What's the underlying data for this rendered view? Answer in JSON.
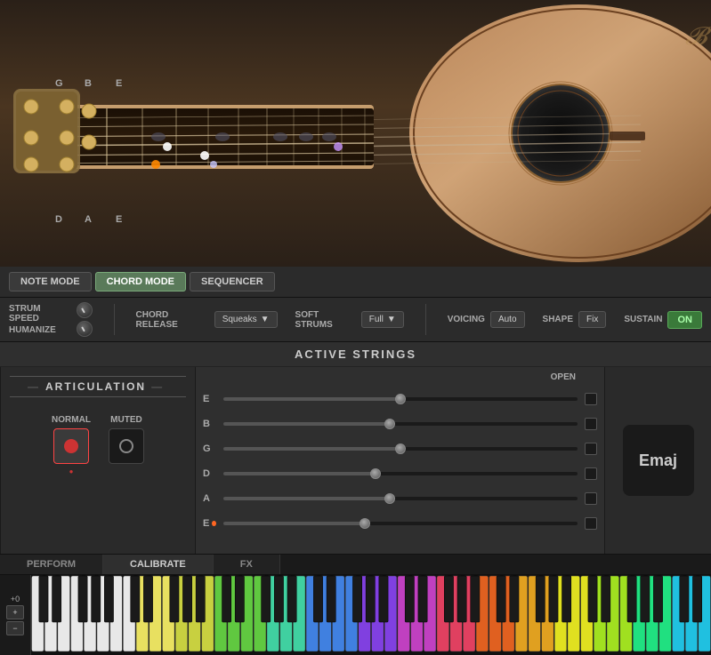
{
  "guitar": {
    "string_labels_top": [
      "G",
      "B",
      "E"
    ],
    "string_labels_bottom": [
      "D",
      "A",
      "E"
    ]
  },
  "modes": {
    "note_mode": "NOTE MODE",
    "chord_mode": "CHORD MODE",
    "sequencer": "SEQUENCER",
    "active": "chord_mode"
  },
  "controls": {
    "strum_speed_label": "STRUM SPEED",
    "humanize_label": "HUMANIZE",
    "chord_release_label": "CHORD RELEASE",
    "chord_release_value": "Squeaks",
    "soft_strums_label": "SOFT STRUMS",
    "soft_strums_value": "Full",
    "voicing_label": "VOICING",
    "voicing_value": "Auto",
    "shape_label": "SHAPE",
    "shape_value": "Fix",
    "sustain_label": "SUSTAIN",
    "sustain_value": "ON"
  },
  "active_strings": {
    "title": "ACTIVE STRINGS",
    "open_label": "OPEN",
    "strings": [
      {
        "name": "E",
        "position": 50,
        "open": false
      },
      {
        "name": "B",
        "position": 47,
        "open": false
      },
      {
        "name": "G",
        "position": 50,
        "open": false
      },
      {
        "name": "D",
        "position": 43,
        "open": false
      },
      {
        "name": "A",
        "position": 47,
        "open": false
      },
      {
        "name": "E",
        "position": 40,
        "open": false,
        "dot": true
      }
    ]
  },
  "articulation": {
    "title": "ARTICULATION",
    "normal_label": "NORMAL",
    "muted_label": "MUTED"
  },
  "chord": {
    "display": "Emaj"
  },
  "tabs": {
    "perform": "PERFORM",
    "calibrate": "CALIBRATE",
    "fx": "FX",
    "active": "calibrate"
  },
  "piano": {
    "pitch_up": "+0",
    "pitch_down": "—"
  }
}
